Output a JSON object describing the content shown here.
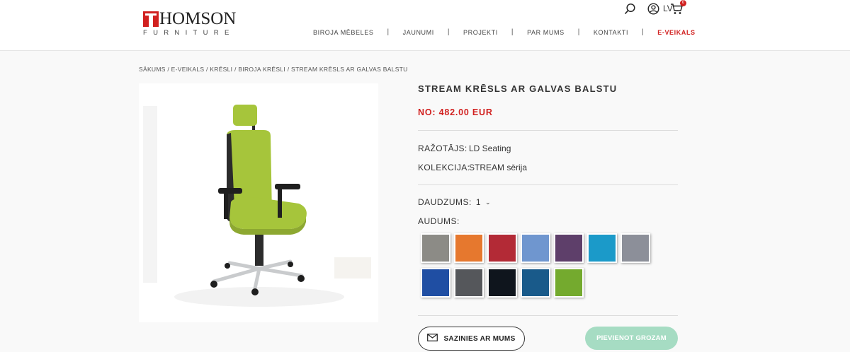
{
  "header": {
    "logo": {
      "main": "HOMSON",
      "sub": "FURNITURE"
    },
    "language": "LV",
    "cart_count": "0",
    "nav": [
      {
        "label": "BIROJA MĒBELES"
      },
      {
        "label": "JAUNUMI"
      },
      {
        "label": "PROJEKTI"
      },
      {
        "label": "PAR MUMS"
      },
      {
        "label": "KONTAKTI"
      },
      {
        "label": "E-VEIKALS"
      }
    ],
    "nav_separator": "|",
    "icons": [
      "search-icon",
      "user-icon",
      "cart-icon"
    ]
  },
  "breadcrumb": "SĀKUMS / E-VEIKALS / KRĒSLI / BIROJA KRĒSLI / STREAM KRĒSLS AR GALVAS BALSTU",
  "product": {
    "title": "STREAM KRĒSLS AR GALVAS BALSTU",
    "price": "NO: 482.00 EUR",
    "manufacturer_label": "RAŽOTĀJS:",
    "manufacturer": "LD Seating",
    "collection_label": "KOLEKCIJA:",
    "collection": "STREAM sērija",
    "quantity_label": "DAUDZUMS:",
    "quantity": "1",
    "fabric_label": "AUDUMS:",
    "fabrics": [
      {
        "color": "#8c8b86"
      },
      {
        "color": "#e6782e"
      },
      {
        "color": "#b32a36"
      },
      {
        "color": "#6f96cf"
      },
      {
        "color": "#5e3f6a"
      },
      {
        "color": "#1b9ac9"
      },
      {
        "color": "#8c8f99"
      },
      {
        "color": "#1f4ea3"
      },
      {
        "color": "#55575b"
      },
      {
        "color": "#0f151d"
      },
      {
        "color": "#195a8a"
      },
      {
        "color": "#74aa2e"
      }
    ],
    "contact_button": "SAZINIES AR MUMS",
    "add_to_cart_button": "PIEVIENOT GROZAM"
  },
  "colors": {
    "accent": "#d1201f",
    "cart_button": "#a6dcc3",
    "chair_fabric": "#a6c53b"
  }
}
